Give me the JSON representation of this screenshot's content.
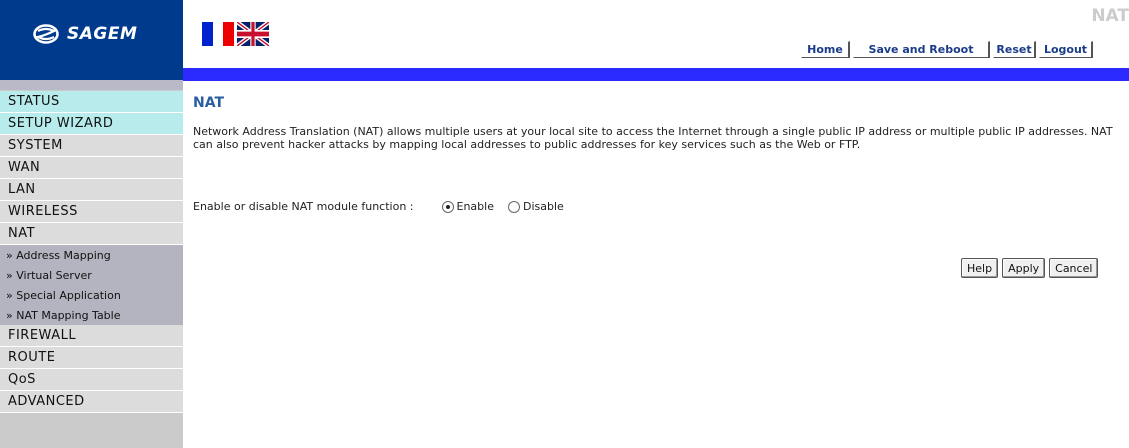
{
  "header": {
    "logo_text": "SAGEM",
    "corner_title": "NAT",
    "buttons": {
      "home": "Home",
      "save_reboot": "Save and Reboot",
      "reset": "Reset",
      "logout": "Logout"
    }
  },
  "sidebar": {
    "items": [
      {
        "label": "STATUS",
        "type": "main",
        "active": true
      },
      {
        "label": "SETUP WIZARD",
        "type": "main",
        "active": true
      },
      {
        "label": "SYSTEM",
        "type": "main"
      },
      {
        "label": "WAN",
        "type": "main"
      },
      {
        "label": "LAN",
        "type": "main"
      },
      {
        "label": "WIRELESS",
        "type": "main"
      },
      {
        "label": "NAT",
        "type": "main"
      },
      {
        "label": "» Address Mapping",
        "type": "sub"
      },
      {
        "label": "» Virtual Server",
        "type": "sub"
      },
      {
        "label": "» Special Application",
        "type": "sub"
      },
      {
        "label": "» NAT Mapping Table",
        "type": "sub"
      },
      {
        "label": "FIREWALL",
        "type": "main"
      },
      {
        "label": "ROUTE",
        "type": "main"
      },
      {
        "label": "QoS",
        "type": "main"
      },
      {
        "label": "ADVANCED",
        "type": "main"
      }
    ]
  },
  "main": {
    "title": "NAT",
    "description": "Network Address Translation (NAT) allows multiple users at your local site to access the Internet through a single public IP address or multiple public IP addresses. NAT can also prevent hacker attacks by mapping local addresses to public addresses for key services such as the Web or FTP.",
    "nat_label": "Enable or disable NAT module function :",
    "enable_label": "Enable",
    "disable_label": "Disable",
    "nat_enabled": true,
    "buttons": {
      "help": "Help",
      "apply": "Apply",
      "cancel": "Cancel"
    }
  },
  "colors": {
    "brand_blue": "#003a8c",
    "accent_bar": "#2b2bff",
    "title_blue": "#2b5ea0"
  }
}
